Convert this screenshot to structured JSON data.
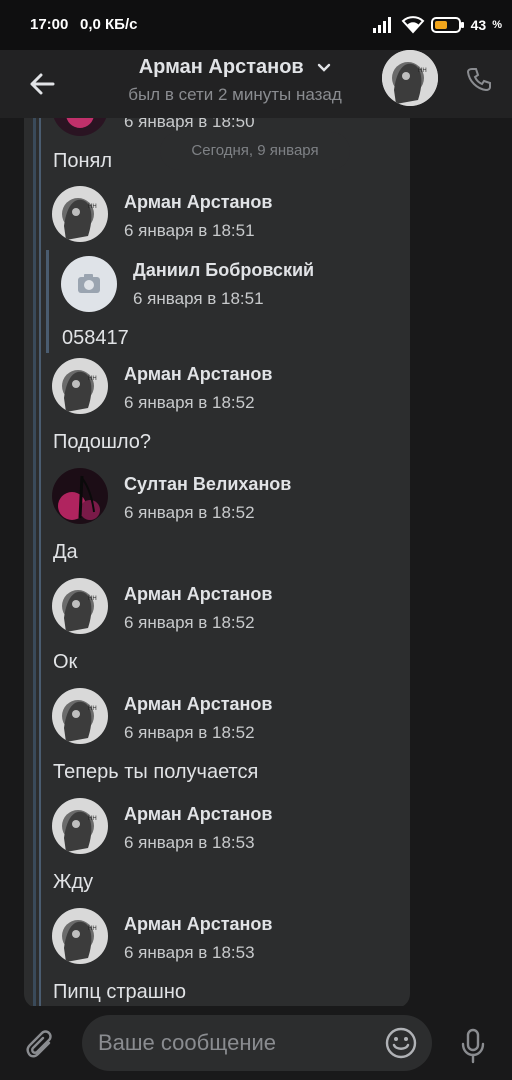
{
  "status_bar": {
    "time": "17:00",
    "net_speed": "0,0 КБ/с",
    "battery_percent": "43",
    "battery_unit": "%",
    "accent_color": "#f1a51c"
  },
  "header": {
    "title": "Арман Арстанов",
    "subtitle": "был в сети 2 минуты назад",
    "back_icon": "arrow-left-icon",
    "call_icon": "phone-icon"
  },
  "date_separator": "Сегодня, 9 января",
  "top_partial_time": "6 января в 18:50",
  "forwarded": [
    {
      "text": "Понял"
    },
    {
      "author": "Арман Арстанов",
      "time": "6 января в 18:51",
      "avatar": "arman"
    },
    {
      "author": "Даниил Бобровский",
      "time": "6 января в 18:51",
      "avatar": "camera-placeholder",
      "text": "058417"
    },
    {
      "author": "Арман Арстанов",
      "time": "6 января в 18:52",
      "avatar": "arman",
      "text": "Подошло?"
    },
    {
      "author": "Султан Велиханов",
      "time": "6 января в 18:52",
      "avatar": "sultan",
      "text": "Да"
    },
    {
      "author": "Арман Арстанов",
      "time": "6 января в 18:52",
      "avatar": "arman",
      "text": "Ок"
    },
    {
      "author": "Арман Арстанов",
      "time": "6 января в 18:52",
      "avatar": "arman",
      "text": "Теперь ты получается"
    },
    {
      "author": "Арман Арстанов",
      "time": "6 января в 18:53",
      "avatar": "arman",
      "text": "Жду"
    },
    {
      "author": "Арман Арстанов",
      "time": "6 января в 18:53",
      "avatar": "arman",
      "text": "Пипц страшно"
    }
  ],
  "composer": {
    "placeholder": "Ваше сообщение",
    "attach_icon": "paperclip-icon",
    "emoji_icon": "smiley-icon",
    "mic_icon": "microphone-icon"
  }
}
